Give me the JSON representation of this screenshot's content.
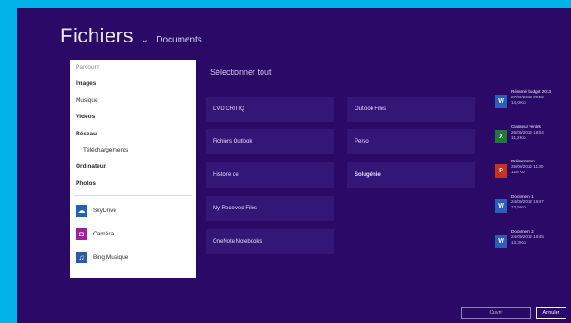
{
  "header": {
    "title": "Fichiers",
    "chevron": "⌄",
    "location": "Documents"
  },
  "dropdown": {
    "heading": "Parcourir",
    "items": [
      {
        "label": "Images",
        "style": "bold"
      },
      {
        "label": "Musique",
        "style": "normal"
      },
      {
        "label": "Vidéos",
        "style": "bold"
      },
      {
        "label": "Réseau",
        "style": "bold"
      },
      {
        "label": "Téléchargements",
        "style": "sub"
      },
      {
        "label": "Ordinateur",
        "style": "bold"
      },
      {
        "label": "Photos",
        "style": "bold"
      }
    ],
    "apps": [
      {
        "label": "SkyDrive",
        "icon": "cloud-icon",
        "color": "#1e63b5",
        "glyph": "☁"
      },
      {
        "label": "Caméra",
        "icon": "camera-icon",
        "color": "#a51d9d",
        "glyph": "◘"
      },
      {
        "label": "Bing Musique",
        "icon": "headphones-icon",
        "color": "#2a5aa8",
        "glyph": "♫"
      }
    ]
  },
  "main": {
    "select_all": "Sélectionner tout",
    "folders_col1": [
      "DVD CRITIQ",
      "Fichiers Outlook",
      "Histoire de",
      "My Received Files",
      "OneNote Notebooks"
    ],
    "folders_col2": [
      "Outlook Files",
      "Perso",
      "Solugénie"
    ],
    "files": [
      {
        "name": "Résumé budget 2013",
        "meta": "27/09/2012 09:52",
        "size": "14,0 Ko",
        "icon": "word-doc-icon",
        "color": "#2b5eb7",
        "glyph": "W"
      },
      {
        "name": "Classeur ventes",
        "meta": "26/09/2012 18:04",
        "size": "11,2 Ko",
        "icon": "excel-doc-icon",
        "color": "#1e7b37",
        "glyph": "X"
      },
      {
        "name": "Présentation",
        "meta": "25/09/2012 11:30",
        "size": "128 Ko",
        "icon": "powerpoint-doc-icon",
        "color": "#c9321f",
        "glyph": "P"
      },
      {
        "name": "Document 1",
        "meta": "24/09/2012 16:47",
        "size": "13,5 Ko",
        "icon": "word-doc-icon",
        "color": "#2b5eb7",
        "glyph": "W"
      },
      {
        "name": "Document 2",
        "meta": "24/09/2012 16:45",
        "size": "13,3 Ko",
        "icon": "word-doc-icon",
        "color": "#2b5eb7",
        "glyph": "W"
      }
    ]
  },
  "footer": {
    "open_label": "Ouvrir",
    "cancel_label": "Annuler"
  }
}
